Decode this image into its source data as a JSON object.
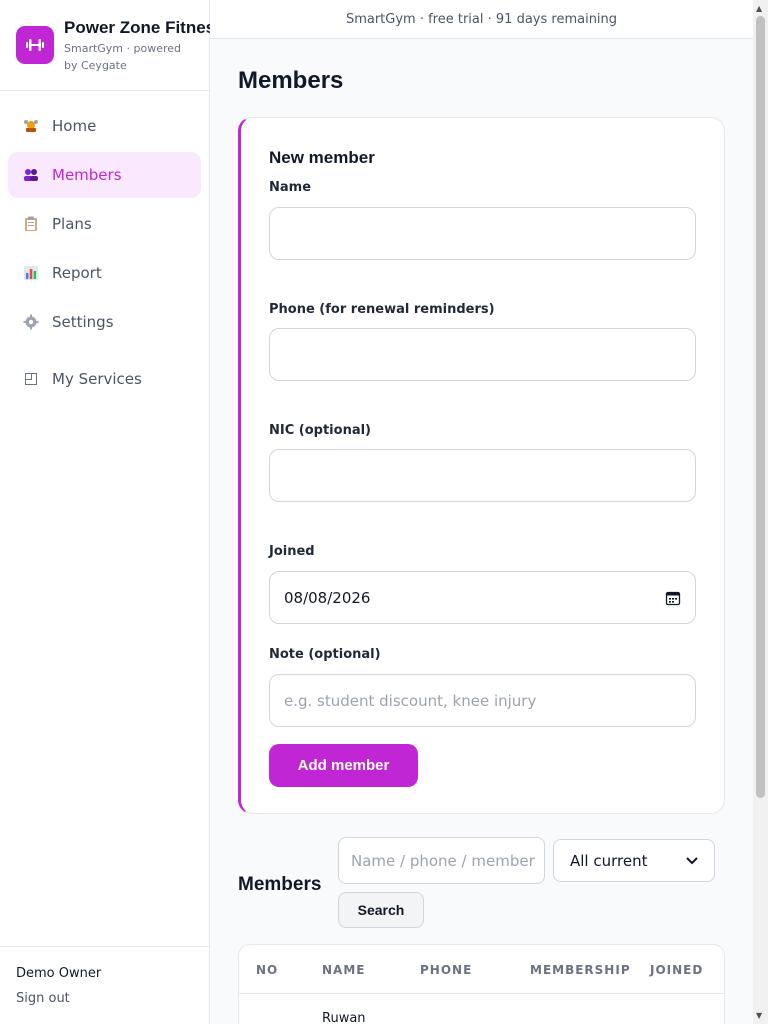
{
  "banner": {
    "text": "SmartGym · free trial · 91 days remaining"
  },
  "brand": {
    "name": "Power Zone Fitness",
    "subtitle": "SmartGym · powered by Ceygate",
    "logo_icon": "dumbbell-icon",
    "accent": "#c026d3"
  },
  "sidebar": {
    "items": [
      {
        "label": "Home",
        "icon": "home-icon"
      },
      {
        "label": "Members",
        "icon": "members-icon",
        "active": true
      },
      {
        "label": "Plans",
        "icon": "clipboard-icon"
      },
      {
        "label": "Report",
        "icon": "bar-chart-icon"
      },
      {
        "label": "Settings",
        "icon": "gear-icon"
      },
      {
        "label": "My Services",
        "icon": "window-icon"
      }
    ],
    "footer": {
      "owner": "Demo Owner",
      "sign_out": "Sign out"
    }
  },
  "page": {
    "title": "Members"
  },
  "form": {
    "title": "New member",
    "name_label": "Name",
    "name_value": "",
    "phone_label": "Phone (for renewal reminders)",
    "phone_value": "",
    "nic_label": "NIC (optional)",
    "nic_value": "",
    "joined_label": "Joined",
    "joined_value": "08/08/2026",
    "note_label": "Note (optional)",
    "note_placeholder": "e.g. student discount, knee injury",
    "submit_label": "Add member"
  },
  "list": {
    "title": "Members",
    "search_placeholder": "Name / phone / member",
    "filter_selected": "All current",
    "search_button": "Search",
    "columns": [
      "NO",
      "NAME",
      "PHONE",
      "MEMBERSHIP",
      "JOINED"
    ],
    "rows": [
      {
        "no": "",
        "name": "Ruwan",
        "phone": "",
        "membership": "",
        "joined": ""
      }
    ]
  }
}
